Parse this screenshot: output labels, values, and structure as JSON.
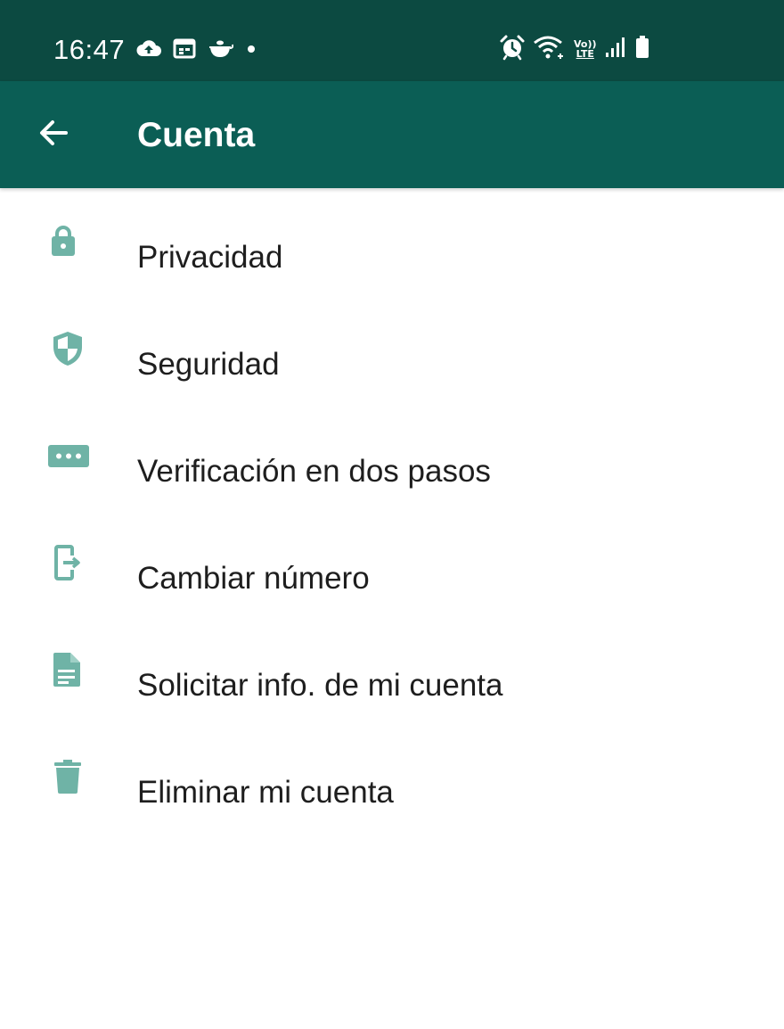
{
  "status_bar": {
    "time": "16:47",
    "left_icons": [
      "cloud-upload-icon",
      "calendar-icon",
      "teapot-icon",
      "dot-icon"
    ],
    "right_icons": [
      "alarm-icon",
      "wifi-icon",
      "volte-icon",
      "signal-icon",
      "battery-icon"
    ],
    "volte_text_top": "Vo))",
    "volte_text_bottom": "LTE"
  },
  "app_bar": {
    "title": "Cuenta",
    "back_icon": "arrow-back-icon"
  },
  "menu": {
    "items": [
      {
        "label": "Privacidad",
        "icon": "lock-icon"
      },
      {
        "label": "Seguridad",
        "icon": "shield-icon"
      },
      {
        "label": "Verificación en dos pasos",
        "icon": "password-dots-icon"
      },
      {
        "label": "Cambiar número",
        "icon": "change-number-icon"
      },
      {
        "label": "Solicitar info. de mi cuenta",
        "icon": "document-icon"
      },
      {
        "label": "Eliminar mi cuenta",
        "icon": "trash-icon"
      }
    ]
  },
  "colors": {
    "status_bar": "#0c4a41",
    "app_bar": "#0b5e55",
    "icon": "#6fb3a6",
    "text": "#1e1e1e"
  }
}
